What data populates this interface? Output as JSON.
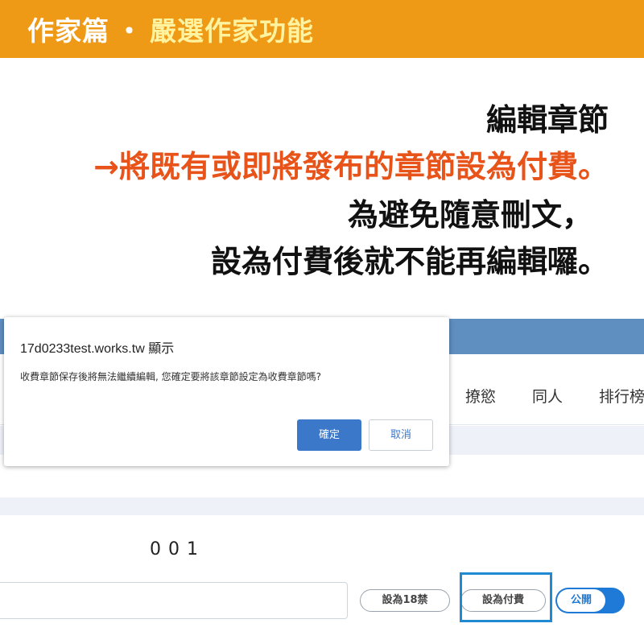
{
  "banner": {
    "title": "作家篇",
    "separator": "・",
    "subtitle": "嚴選作家功能",
    "bg_color": "#ee9a17"
  },
  "caption": {
    "line1": "編輯章節",
    "line2": "→將既有或即將發布的章節設為付費。",
    "line3": "為避免隨意刪文，",
    "line4": "設為付費後就不能再編輯囉。",
    "highlight_color": "#e8531a"
  },
  "site": {
    "nav": [
      "撩慾",
      "同人",
      "排行榜"
    ],
    "chapter_number": "001",
    "buttons": {
      "set_18_label": "設為18禁",
      "set_paid_label": "設為付費",
      "public_toggle_label": "公開"
    },
    "accent_color": "#1e7ad6",
    "topbar_color": "#5f8ec1"
  },
  "dialog": {
    "title": "17d0233test.works.tw 顯示",
    "message": "收費章節保存後將無法繼續編輯, 您確定要將該章節設定為收費章節嗎?",
    "ok_label": "確定",
    "cancel_label": "取消"
  }
}
